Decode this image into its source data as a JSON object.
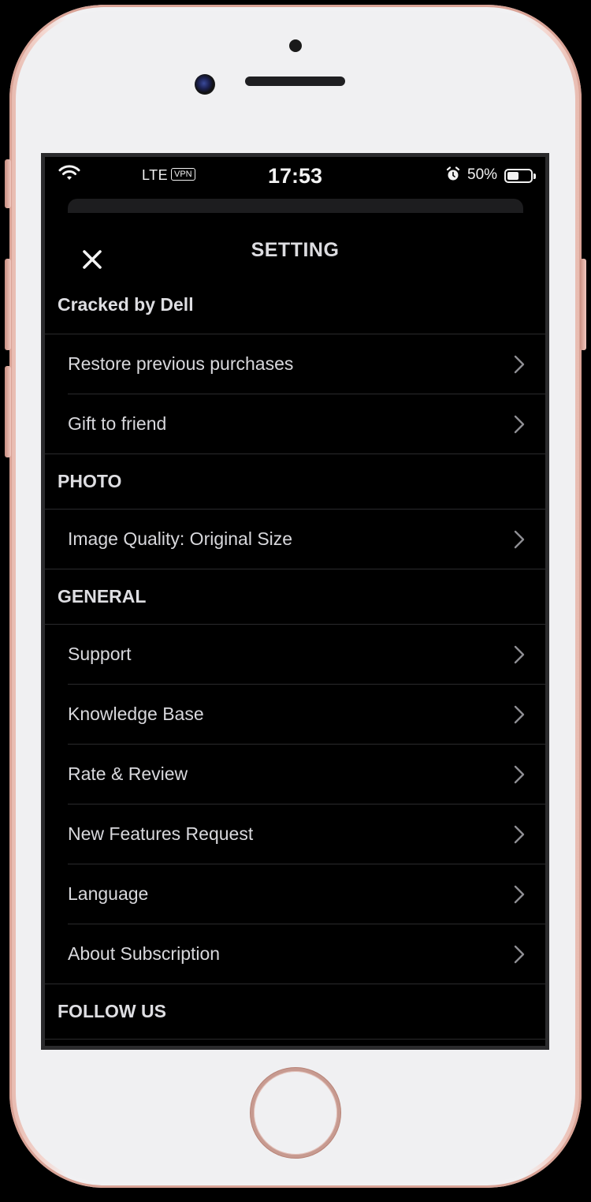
{
  "status_bar": {
    "carrier": "LTE",
    "vpn": "VPN",
    "time": "17:53",
    "battery_text": "50%",
    "battery_level": 0.5,
    "icons": [
      "wifi-icon",
      "alarm-icon",
      "battery-icon"
    ]
  },
  "header": {
    "title": "SETTING",
    "close_icon": "close-icon"
  },
  "sections": {
    "account": {
      "title": "Cracked by Dell",
      "items": [
        "Restore previous purchases",
        "Gift to friend"
      ]
    },
    "photo": {
      "title": "PHOTO",
      "items": [
        "Image Quality: Original Size"
      ]
    },
    "general": {
      "title": "GENERAL",
      "items": [
        "Support",
        "Knowledge Base",
        "Rate & Review",
        "New Features Request",
        "Language",
        "About Subscription"
      ]
    },
    "follow": {
      "title": "FOLLOW US"
    }
  },
  "colors": {
    "background": "#000000",
    "text": "#d8d8dc",
    "separator": "#2a2a2c",
    "phone_rose_gold": "#e7b9ae"
  }
}
